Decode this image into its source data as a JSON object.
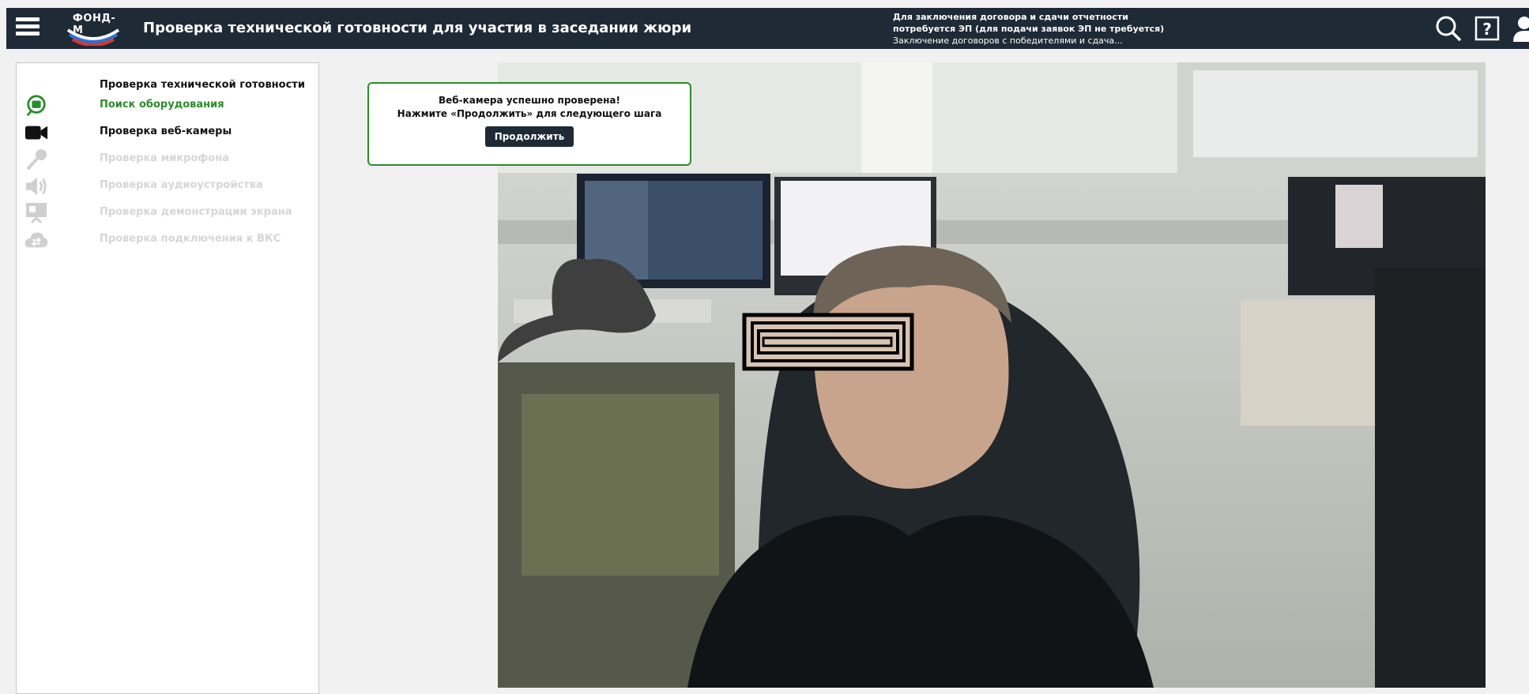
{
  "header": {
    "logo_text": "ФОНД-М",
    "title": "Проверка технической готовности для участия в заседании жюри",
    "notice_line1": "Для заключения договора и сдачи отчетности",
    "notice_line2": "потребуется ЭП (для подачи заявок ЭП не требуется)",
    "notice_line3": "Заключение договоров с победителями и сдача...",
    "icons": [
      "menu-icon",
      "search-icon",
      "help-icon",
      "user-icon"
    ]
  },
  "sidebar": {
    "heading": "Проверка технической готовности",
    "steps": [
      {
        "label": "Поиск оборудования",
        "icon": "search-chat-icon",
        "state": "active"
      },
      {
        "label": "Проверка веб-камеры",
        "icon": "camera-icon",
        "state": "current"
      },
      {
        "label": "Проверка микрофона",
        "icon": "microphone-icon",
        "state": "pending"
      },
      {
        "label": "Проверка аудиоустройства",
        "icon": "speaker-icon",
        "state": "pending"
      },
      {
        "label": "Проверка демонстрации экрана",
        "icon": "screen-share-icon",
        "state": "pending"
      },
      {
        "label": "Проверка подключения к ВКС",
        "icon": "cloud-connection-icon",
        "state": "pending"
      }
    ]
  },
  "toast": {
    "line1": "Веб-камера успешно проверена!",
    "line2": "Нажмите «Продолжить» для следующего шага",
    "button_label": "Продолжить"
  },
  "colors": {
    "header_bg": "#1f2a37",
    "accent_green": "#2e8a2e",
    "pending_gray": "#d6d6d6",
    "page_bg": "#f1f1f1"
  }
}
